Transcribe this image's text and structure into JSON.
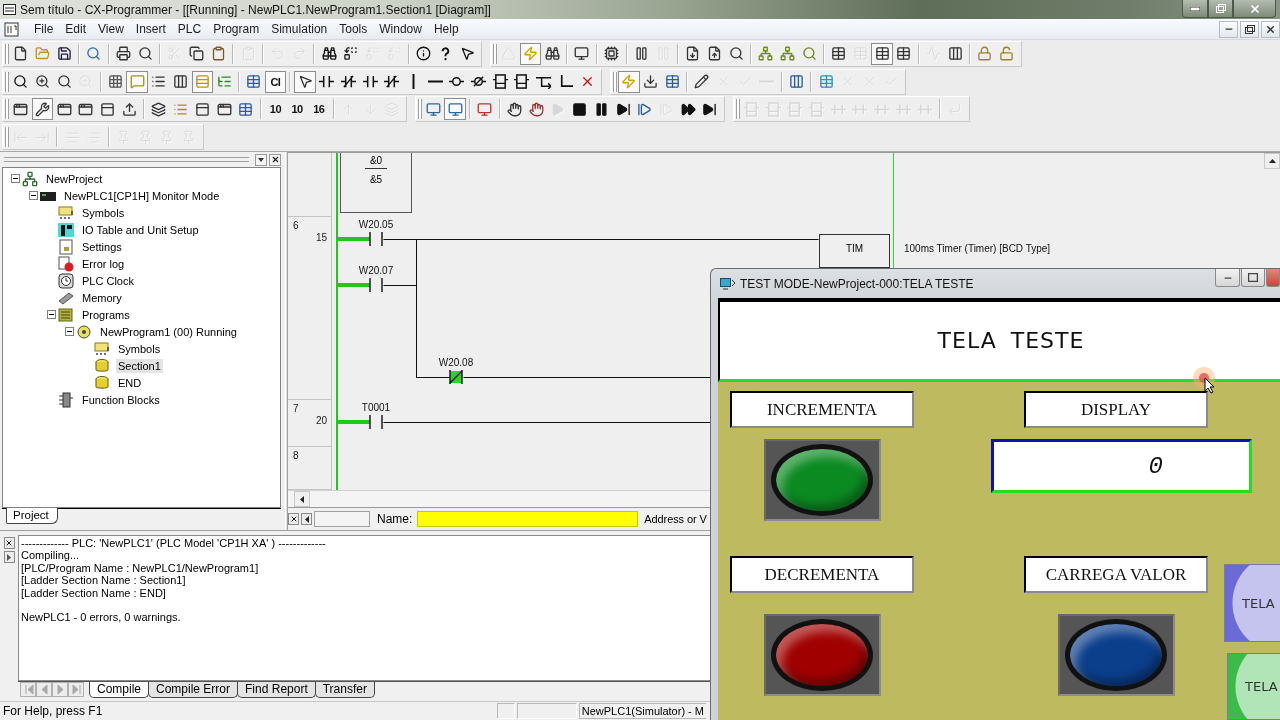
{
  "window": {
    "title": "Sem título - CX-Programmer - [[Running] - NewPLC1.NewProgram1.Section1 [Diagram]]"
  },
  "menu": [
    "File",
    "Edit",
    "View",
    "Insert",
    "PLC",
    "Program",
    "Simulation",
    "Tools",
    "Window",
    "Help"
  ],
  "toolbar_rows": [
    {
      "toolbars": [
        {
          "groups": [
            [
              {
                "disabled": false,
                "pressed": false
              },
              {
                "disabled": false,
                "pressed": false
              },
              {
                "disabled": false,
                "pressed": false
              }
            ],
            [
              {
                "disabled": false,
                "pressed": false
              }
            ],
            [
              {
                "disabled": false,
                "pressed": false
              },
              {
                "disabled": false,
                "pressed": false
              }
            ],
            [
              {
                "disabled": true,
                "pressed": false
              },
              {
                "disabled": false,
                "pressed": false
              },
              {
                "disabled": false,
                "pressed": false
              }
            ],
            [
              {
                "disabled": true,
                "pressed": false
              }
            ],
            [
              {
                "disabled": true,
                "pressed": false
              },
              {
                "disabled": true,
                "pressed": false
              }
            ],
            [
              {
                "disabled": false,
                "pressed": false
              },
              {
                "disabled": false,
                "pressed": false
              },
              {
                "disabled": true,
                "pressed": false
              },
              {
                "disabled": true,
                "pressed": false
              }
            ],
            [
              {
                "disabled": false,
                "pressed": false
              },
              {
                "disabled": false,
                "pressed": false
              },
              {
                "disabled": false,
                "pressed": false
              }
            ]
          ]
        },
        {
          "groups": [
            [
              {
                "disabled": true,
                "pressed": false
              },
              {
                "disabled": false,
                "pressed": true
              },
              {
                "disabled": false,
                "pressed": false
              }
            ],
            [
              {
                "disabled": false,
                "pressed": false
              }
            ],
            [
              {
                "disabled": false,
                "pressed": false
              }
            ],
            [
              {
                "disabled": false,
                "pressed": false
              },
              {
                "disabled": true,
                "pressed": false
              }
            ],
            [
              {
                "disabled": false,
                "pressed": false
              },
              {
                "disabled": false,
                "pressed": false
              },
              {
                "disabled": false,
                "pressed": false
              }
            ],
            [
              {
                "disabled": false,
                "pressed": false
              },
              {
                "disabled": false,
                "pressed": false
              },
              {
                "disabled": false,
                "pressed": false
              }
            ],
            [
              {
                "disabled": false,
                "pressed": false
              },
              {
                "disabled": true,
                "pressed": false
              },
              {
                "disabled": false,
                "pressed": true
              },
              {
                "disabled": false,
                "pressed": false
              }
            ],
            [
              {
                "disabled": true,
                "pressed": false
              },
              {
                "disabled": false,
                "pressed": false
              }
            ],
            [
              {
                "disabled": false,
                "pressed": false
              },
              {
                "disabled": false,
                "pressed": false
              }
            ]
          ]
        }
      ]
    },
    {
      "toolbars": [
        {
          "groups": [
            [
              {
                "disabled": false,
                "pressed": false
              },
              {
                "disabled": false,
                "pressed": false
              },
              {
                "disabled": false,
                "pressed": false
              },
              {
                "disabled": true,
                "pressed": false
              }
            ],
            [
              {
                "disabled": false,
                "pressed": false
              },
              {
                "disabled": false,
                "pressed": true
              },
              {
                "disabled": false,
                "pressed": false
              },
              {
                "disabled": false,
                "pressed": false
              },
              {
                "disabled": false,
                "pressed": true
              },
              {
                "disabled": false,
                "pressed": false
              }
            ],
            [
              {
                "disabled": false,
                "pressed": false
              },
              {
                "label": "CI",
                "disabled": false,
                "pressed": true
              }
            ],
            [
              {
                "disabled": false,
                "pressed": true
              },
              {
                "disabled": false,
                "pressed": false
              },
              {
                "disabled": false,
                "pressed": false
              },
              {
                "disabled": false,
                "pressed": false
              },
              {
                "disabled": false,
                "pressed": false
              },
              {
                "disabled": false,
                "pressed": false
              },
              {
                "disabled": false,
                "pressed": false
              },
              {
                "disabled": false,
                "pressed": false
              },
              {
                "disabled": false,
                "pressed": false
              },
              {
                "disabled": false,
                "pressed": false
              },
              {
                "disabled": false,
                "pressed": false
              },
              {
                "disabled": false,
                "pressed": false
              },
              {
                "disabled": false,
                "pressed": false
              },
              {
                "disabled": false,
                "pressed": false
              }
            ]
          ]
        },
        {
          "groups": [
            [
              {
                "disabled": false,
                "pressed": true
              },
              {
                "disabled": false,
                "pressed": false
              },
              {
                "disabled": false,
                "pressed": false
              }
            ],
            [
              {
                "disabled": false,
                "pressed": false
              },
              {
                "disabled": true,
                "pressed": false
              },
              {
                "disabled": true,
                "pressed": false
              },
              {
                "disabled": true,
                "pressed": false
              }
            ],
            [
              {
                "disabled": false,
                "pressed": false
              }
            ],
            [
              {
                "disabled": false,
                "pressed": false
              },
              {
                "disabled": true,
                "pressed": false
              },
              {
                "disabled": true,
                "pressed": false
              },
              {
                "disabled": true,
                "pressed": false
              }
            ]
          ]
        }
      ]
    },
    {
      "toolbars": [
        {
          "groups": [
            [
              {
                "disabled": false,
                "pressed": false
              },
              {
                "disabled": false,
                "pressed": true
              },
              {
                "disabled": false,
                "pressed": false
              },
              {
                "disabled": false,
                "pressed": false
              },
              {
                "disabled": false,
                "pressed": false
              },
              {
                "disabled": false,
                "pressed": false
              }
            ],
            [
              {
                "disabled": false,
                "pressed": false
              },
              {
                "disabled": false,
                "pressed": false
              },
              {
                "disabled": false,
                "pressed": false
              },
              {
                "disabled": false,
                "pressed": false
              },
              {
                "disabled": false,
                "pressed": false
              }
            ],
            [
              {
                "label": "10",
                "disabled": false,
                "pressed": false
              },
              {
                "label": "10",
                "disabled": false,
                "pressed": false
              },
              {
                "label": "16",
                "disabled": false,
                "pressed": false
              }
            ],
            [
              {
                "disabled": true,
                "pressed": false
              },
              {
                "disabled": true,
                "pressed": false
              },
              {
                "disabled": true,
                "pressed": false
              }
            ]
          ]
        },
        {
          "groups": [
            [
              {
                "disabled": false,
                "pressed": false
              },
              {
                "disabled": false,
                "pressed": true
              }
            ],
            [
              {
                "disabled": false,
                "pressed": false
              }
            ],
            [
              {
                "disabled": false,
                "pressed": false
              },
              {
                "disabled": false,
                "pressed": false
              },
              {
                "disabled": true,
                "pressed": false
              },
              {
                "disabled": false,
                "pressed": false
              },
              {
                "disabled": false,
                "pressed": false
              },
              {
                "disabled": false,
                "pressed": false
              },
              {
                "disabled": false,
                "pressed": false
              },
              {
                "disabled": true,
                "pressed": false
              },
              {
                "disabled": false,
                "pressed": false
              },
              {
                "disabled": false,
                "pressed": false
              }
            ]
          ]
        },
        {
          "groups": [
            [
              {
                "disabled": true,
                "pressed": false
              },
              {
                "disabled": true,
                "pressed": false
              },
              {
                "disabled": true,
                "pressed": false
              },
              {
                "disabled": true,
                "pressed": false
              },
              {
                "disabled": true,
                "pressed": false
              },
              {
                "disabled": true,
                "pressed": false
              },
              {
                "disabled": true,
                "pressed": false
              },
              {
                "disabled": true,
                "pressed": false
              },
              {
                "disabled": true,
                "pressed": false
              }
            ],
            [
              {
                "disabled": true,
                "pressed": false
              }
            ]
          ]
        }
      ]
    },
    {
      "toolbars": [
        {
          "groups": [
            [
              {
                "disabled": true,
                "pressed": false
              },
              {
                "disabled": true,
                "pressed": false
              }
            ],
            [
              {
                "disabled": true,
                "pressed": false
              },
              {
                "disabled": true,
                "pressed": false
              }
            ],
            [
              {
                "disabled": true,
                "pressed": false
              },
              {
                "disabled": true,
                "pressed": false
              },
              {
                "disabled": true,
                "pressed": false
              },
              {
                "disabled": true,
                "pressed": false
              }
            ]
          ]
        }
      ]
    }
  ],
  "project_panel": {
    "tree": [
      {
        "label": "NewProject",
        "kind": "project",
        "expanded": true,
        "selected": false,
        "children": [
          {
            "label": "NewPLC1[CP1H] Monitor Mode",
            "kind": "plc",
            "expanded": true,
            "selected": false,
            "children": [
              {
                "label": "Symbols",
                "kind": "symbols",
                "selected": false
              },
              {
                "label": "IO Table and Unit Setup",
                "kind": "io_table",
                "selected": false
              },
              {
                "label": "Settings",
                "kind": "settings",
                "selected": false
              },
              {
                "label": "Error log",
                "kind": "error_log",
                "selected": false
              },
              {
                "label": "PLC Clock",
                "kind": "clock",
                "selected": false
              },
              {
                "label": "Memory",
                "kind": "memory",
                "selected": false
              },
              {
                "label": "Programs",
                "kind": "programs",
                "expanded": true,
                "selected": false,
                "children": [
                  {
                    "label": "NewProgram1 (00) Running",
                    "kind": "program",
                    "expanded": true,
                    "selected": false,
                    "children": [
                      {
                        "label": "Symbols",
                        "kind": "symbols",
                        "selected": false
                      },
                      {
                        "label": "Section1",
                        "kind": "section",
                        "selected": true
                      },
                      {
                        "label": "END",
                        "kind": "section",
                        "selected": false
                      }
                    ]
                  }
                ]
              },
              {
                "label": "Function Blocks",
                "kind": "function_blocks",
                "selected": false
              }
            ]
          }
        ]
      }
    ],
    "tabs": [
      {
        "label": "Project",
        "selected": true
      }
    ]
  },
  "ladder": {
    "partial_block": {
      "operands": [
        "&0",
        "&5"
      ]
    },
    "rungs": [
      {
        "number": "6",
        "step": "15",
        "contacts": [
          {
            "address": "W20.05",
            "kind": "no",
            "powered": true,
            "highlighted": false
          },
          {
            "address": "W20.07",
            "kind": "no",
            "powered": true,
            "highlighted": false
          },
          {
            "address": "W20.08",
            "kind": "nc",
            "powered": false,
            "highlighted": true
          }
        ],
        "output": {
          "instruction": "TIM",
          "comment": "100ms Timer (Timer) [BCD Type]"
        }
      },
      {
        "number": "7",
        "step": "20",
        "contacts": [
          {
            "address": "T0001",
            "kind": "no",
            "powered": true,
            "highlighted": false
          }
        ]
      },
      {
        "number": "8"
      }
    ],
    "name_bar": {
      "name_label": "Name:",
      "address_label": "Address or V"
    }
  },
  "output": {
    "header": "------------- PLC: 'NewPLC1' (PLC Model 'CP1H XA' ) -------------",
    "lines": [
      "Compiling...",
      "[PLC/Program Name : NewPLC1/NewProgram1]",
      "[Ladder Section Name : Section1]",
      "[Ladder Section Name : END]"
    ],
    "summary": "NewPLC1 - 0 errors, 0 warnings.",
    "tabs": [
      {
        "label": "Compile",
        "selected": true
      },
      {
        "label": "Compile Error",
        "selected": false
      },
      {
        "label": "Find Report",
        "selected": false
      },
      {
        "label": "Transfer",
        "selected": false
      }
    ]
  },
  "status_bar": {
    "help": "For Help, press F1",
    "connection": "NewPLC1(Simulator) - M"
  },
  "test_window": {
    "title": "TEST MODE-NewProject-000:TELA TESTE",
    "screen_title": "TELA TESTE",
    "controls": [
      {
        "label": "INCREMENTA",
        "kind": "button",
        "color": "#0c8a22"
      },
      {
        "label": "DISPLAY",
        "kind": "display",
        "value": "0"
      },
      {
        "label": "DECREMENTA",
        "kind": "button",
        "color": "#a00000"
      },
      {
        "label": "CARREGA VALOR",
        "kind": "button",
        "color": "#0b3f8c"
      }
    ],
    "side_buttons": [
      {
        "label": "TELA",
        "color": "#6b6bd8"
      },
      {
        "label": "TELA",
        "color": "#3dbb4a"
      }
    ]
  }
}
